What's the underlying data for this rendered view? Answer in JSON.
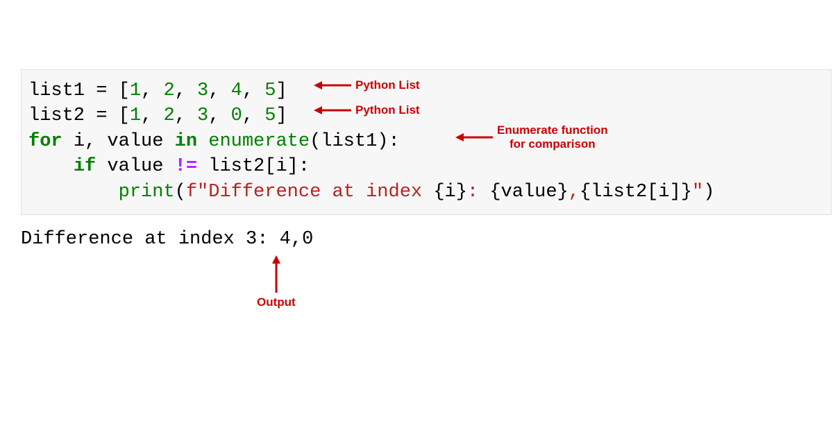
{
  "code": {
    "line1": {
      "var": "list1",
      "eq": " = ",
      "open": "[",
      "n1": "1",
      "c1": ", ",
      "n2": "2",
      "c2": ", ",
      "n3": "3",
      "c3": ", ",
      "n4": "4",
      "c4": ", ",
      "n5": "5",
      "close": "]"
    },
    "line2": {
      "var": "list2",
      "eq": " = ",
      "open": "[",
      "n1": "1",
      "c1": ", ",
      "n2": "2",
      "c2": ", ",
      "n3": "3",
      "c3": ", ",
      "n4": "0",
      "c4": ", ",
      "n5": "5",
      "close": "]"
    },
    "line3": {
      "kw_for": "for",
      "sp1": " ",
      "var_i": "i, value",
      "sp2": " ",
      "kw_in": "in",
      "sp3": " ",
      "builtin": "enumerate",
      "open": "(",
      "arg": "list1",
      "close": "):"
    },
    "line4": {
      "indent": "    ",
      "kw_if": "if",
      "sp1": " ",
      "var": "value ",
      "neq": "!=",
      "rest": " list2[i]:"
    },
    "line5": {
      "indent": "        ",
      "print": "print",
      "open": "(",
      "fprefix": "f\"",
      "text1": "Difference at index ",
      "brace1": "{i}",
      "text2": ": ",
      "brace2": "{value}",
      "text3": ",",
      "brace3": "{list2[i]}",
      "strclose": "\"",
      "close": ")"
    }
  },
  "output": {
    "text": "Difference at index 3: 4,0"
  },
  "annotations": {
    "list1_label": "Python List",
    "list2_label": "Python List",
    "enumerate_label_l1": "Enumerate function",
    "enumerate_label_l2": "for comparison",
    "output_label": "Output"
  }
}
